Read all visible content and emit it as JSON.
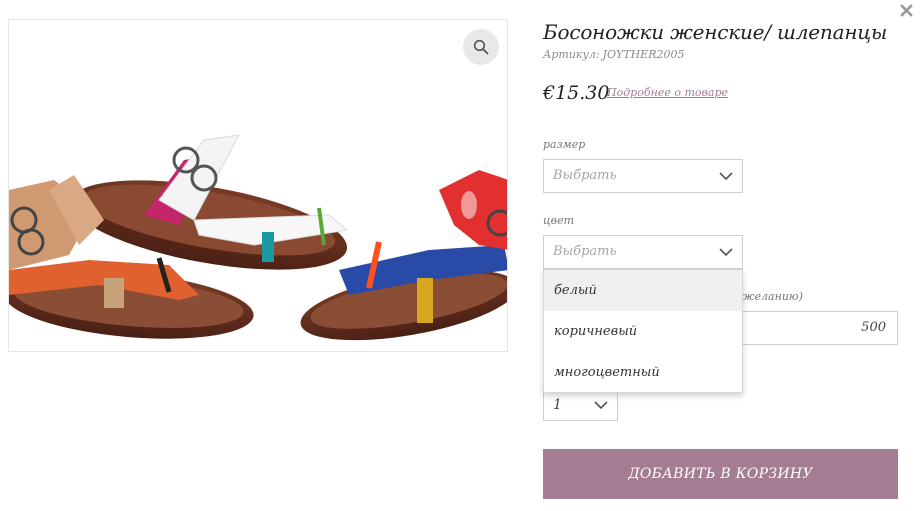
{
  "product": {
    "title": "Босоножки женские/ шлепанцы",
    "sku_label": "Артикул:",
    "sku": "JOYTHER2005",
    "price": "€15.30",
    "details_link": "Подробнее о товаре"
  },
  "size_field": {
    "label": "размер",
    "value": "Выбрать"
  },
  "color_field": {
    "label": "цвет",
    "value": "Выбрать",
    "options": [
      "белый",
      "коричневый",
      "многоцветный"
    ]
  },
  "amount_field": {
    "hint": "желанию)",
    "value": "500"
  },
  "quantity": {
    "value": "1"
  },
  "add_to_cart": "ДОБАВИТЬ В КОРЗИНУ",
  "colors": {
    "accent": "#a47d92",
    "border": "#cfcfcf"
  },
  "icons": {
    "close": "close-icon",
    "zoom": "search-icon",
    "chevron": "chevron-down-icon"
  }
}
